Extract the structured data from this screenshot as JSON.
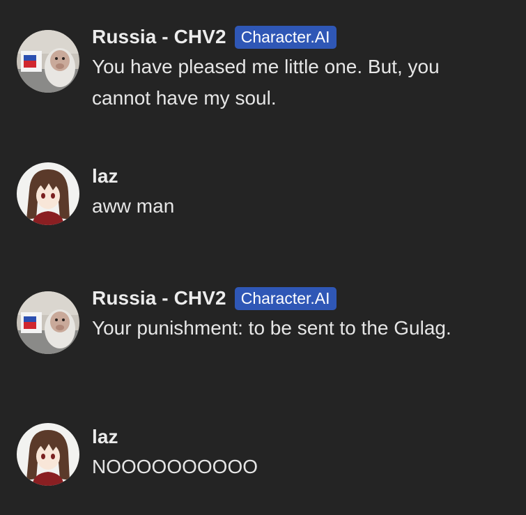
{
  "colors": {
    "background": "#242424",
    "badge": "#2f57b6",
    "text": "#ececec"
  },
  "messages": [
    {
      "author": "Russia - CHV2",
      "badge": "Character.AI",
      "text": "You have pleased me little one. But, you cannot have my soul.",
      "avatar": "monkey-with-russian-flag-avatar"
    },
    {
      "author": "laz",
      "text": "aww man",
      "avatar": "anime-girl-avatar"
    },
    {
      "author": "Russia - CHV2",
      "badge": "Character.AI",
      "text": "Your punishment: to be sent to the Gulag.",
      "avatar": "monkey-with-russian-flag-avatar"
    },
    {
      "author": "laz",
      "text": "NOOOOOOOOOO",
      "avatar": "anime-girl-avatar"
    }
  ]
}
